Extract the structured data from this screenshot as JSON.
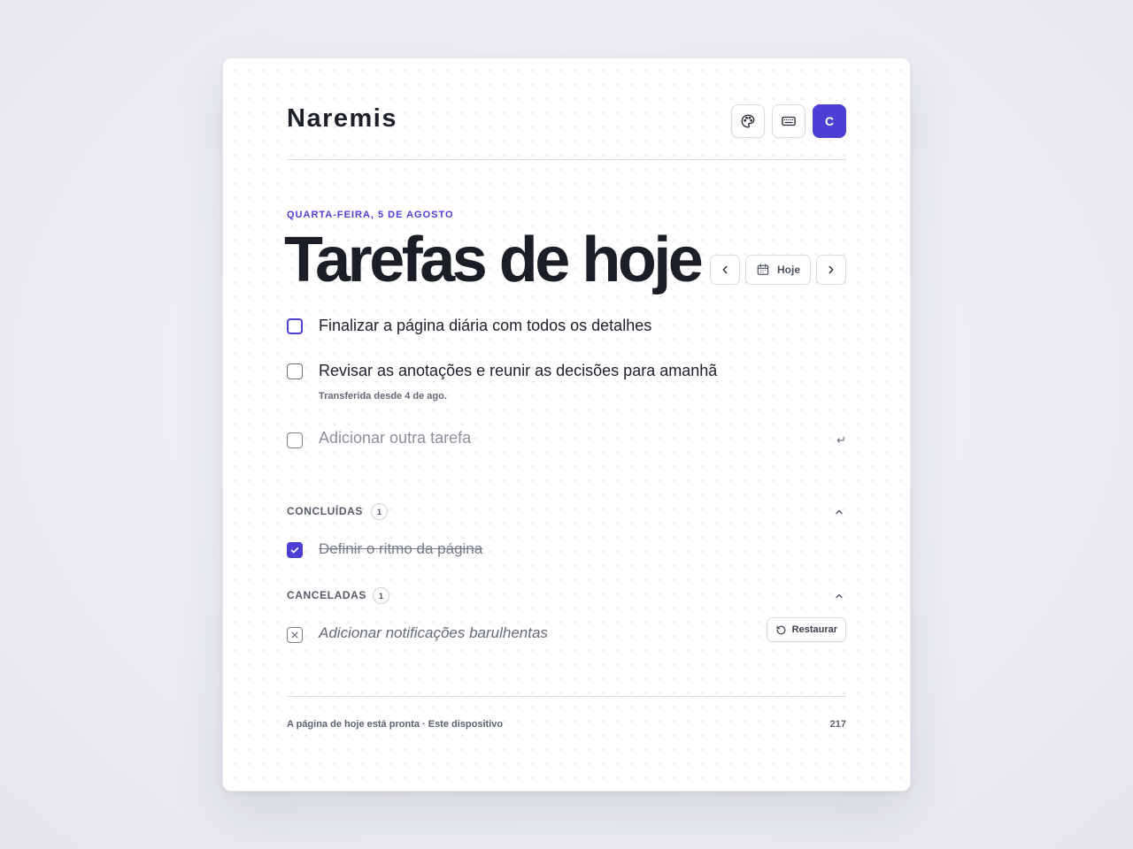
{
  "app": {
    "brand": "Naremis",
    "avatar_initial": "C"
  },
  "icons": {
    "theme": "palette-icon",
    "keyboard": "keyboard-icon",
    "prev": "chevron-left-icon",
    "next": "chevron-right-icon",
    "calendar": "calendar-icon",
    "enter": "enter-icon",
    "restore": "restore-icon"
  },
  "header": {
    "date_label": "QUARTA-FEIRA, 5 DE AGOSTO",
    "title": "Tarefas de hoje",
    "today_label": "Hoje"
  },
  "tasks": [
    {
      "text": "Finalizar a página diária com todos os detalhes",
      "sub": ""
    },
    {
      "text": "Revisar as anotações e reunir as decisões para amanhã",
      "sub": "Transferida desde 4 de ago."
    }
  ],
  "add_task": {
    "placeholder": "Adicionar outra tarefa",
    "enter_glyph": "↵"
  },
  "completed": {
    "title": "CONCLUÍDAS",
    "count": "1",
    "items": [
      {
        "text": "Definir o ritmo da página"
      }
    ]
  },
  "cancelled": {
    "title": "CANCELADAS",
    "count": "1",
    "items": [
      {
        "text": "Adicionar notificações barulhentas",
        "restore_label": "Restaurar"
      }
    ]
  },
  "footer": {
    "status": "A página de hoje está pronta · Este dispositivo",
    "counter": "217"
  },
  "colors": {
    "accent": "#4b3fd4",
    "text": "#1b1e27",
    "muted": "#656a76"
  }
}
